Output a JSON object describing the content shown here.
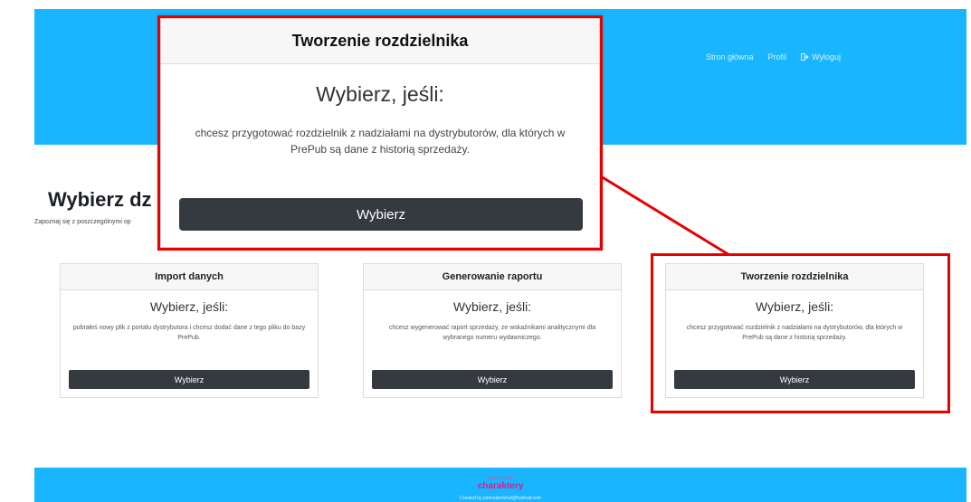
{
  "nav": {
    "home": "Stron główna",
    "profile": "Profil",
    "logout": "Wyloguj"
  },
  "page": {
    "title": "Wybierz dz",
    "subtitle": "Zapoznaj się z poszczególnymi op"
  },
  "cards": [
    {
      "header": "Import danych",
      "lead": "Wybierz, jeśli:",
      "description": "pobrałeś nowy plik z portalu dystrybutora i chcesz dodać dane z tego pliku do bazy PrePub.",
      "button": "Wybierz"
    },
    {
      "header": "Generowanie raportu",
      "lead": "Wybierz, jeśli:",
      "description": "chcesz wygenerować raport sprzedaży, ze wskaźnikami analitycznymi dla wybranego numeru wydawniczego.",
      "button": "Wybierz"
    },
    {
      "header": "Tworzenie rozdzielnika",
      "lead": "Wybierz, jeśli:",
      "description": "chcesz przygotować rozdzielnik z nadziałami na dystrybutorów, dla których w PrePub są dane z historią sprzedaży.",
      "button": "Wybierz"
    }
  ],
  "zoom": {
    "header": "Tworzenie rozdzielnika",
    "lead": "Wybierz, jeśli:",
    "description": "chcesz przygotować rozdzielnik z nadziałami na dystrybutorów, dla których w PrePub są dane z historią sprzedaży.",
    "button": "Wybierz"
  },
  "footer": {
    "tagline": "Zebrać znaki",
    "brand": "charaktery",
    "credit": "Created by pietrzakmichal@hotmail.com"
  },
  "colors": {
    "header_bg": "#1ab5ff",
    "button_bg": "#343a40",
    "highlight": "#e60000",
    "brand": "#d61f8c"
  }
}
